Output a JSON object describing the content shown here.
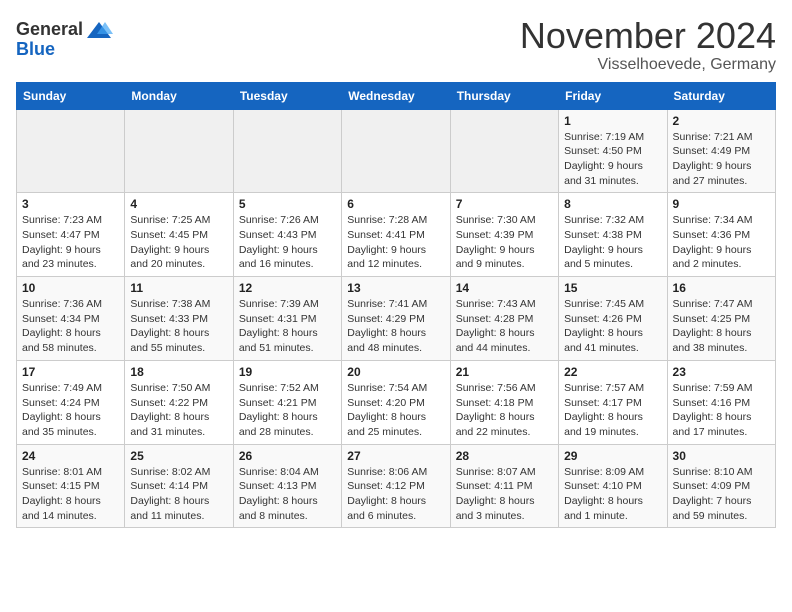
{
  "header": {
    "logo_general": "General",
    "logo_blue": "Blue",
    "month_title": "November 2024",
    "subtitle": "Visselhoevede, Germany"
  },
  "days_of_week": [
    "Sunday",
    "Monday",
    "Tuesday",
    "Wednesday",
    "Thursday",
    "Friday",
    "Saturday"
  ],
  "weeks": [
    [
      {
        "day": "",
        "detail": ""
      },
      {
        "day": "",
        "detail": ""
      },
      {
        "day": "",
        "detail": ""
      },
      {
        "day": "",
        "detail": ""
      },
      {
        "day": "",
        "detail": ""
      },
      {
        "day": "1",
        "detail": "Sunrise: 7:19 AM\nSunset: 4:50 PM\nDaylight: 9 hours and 31 minutes."
      },
      {
        "day": "2",
        "detail": "Sunrise: 7:21 AM\nSunset: 4:49 PM\nDaylight: 9 hours and 27 minutes."
      }
    ],
    [
      {
        "day": "3",
        "detail": "Sunrise: 7:23 AM\nSunset: 4:47 PM\nDaylight: 9 hours and 23 minutes."
      },
      {
        "day": "4",
        "detail": "Sunrise: 7:25 AM\nSunset: 4:45 PM\nDaylight: 9 hours and 20 minutes."
      },
      {
        "day": "5",
        "detail": "Sunrise: 7:26 AM\nSunset: 4:43 PM\nDaylight: 9 hours and 16 minutes."
      },
      {
        "day": "6",
        "detail": "Sunrise: 7:28 AM\nSunset: 4:41 PM\nDaylight: 9 hours and 12 minutes."
      },
      {
        "day": "7",
        "detail": "Sunrise: 7:30 AM\nSunset: 4:39 PM\nDaylight: 9 hours and 9 minutes."
      },
      {
        "day": "8",
        "detail": "Sunrise: 7:32 AM\nSunset: 4:38 PM\nDaylight: 9 hours and 5 minutes."
      },
      {
        "day": "9",
        "detail": "Sunrise: 7:34 AM\nSunset: 4:36 PM\nDaylight: 9 hours and 2 minutes."
      }
    ],
    [
      {
        "day": "10",
        "detail": "Sunrise: 7:36 AM\nSunset: 4:34 PM\nDaylight: 8 hours and 58 minutes."
      },
      {
        "day": "11",
        "detail": "Sunrise: 7:38 AM\nSunset: 4:33 PM\nDaylight: 8 hours and 55 minutes."
      },
      {
        "day": "12",
        "detail": "Sunrise: 7:39 AM\nSunset: 4:31 PM\nDaylight: 8 hours and 51 minutes."
      },
      {
        "day": "13",
        "detail": "Sunrise: 7:41 AM\nSunset: 4:29 PM\nDaylight: 8 hours and 48 minutes."
      },
      {
        "day": "14",
        "detail": "Sunrise: 7:43 AM\nSunset: 4:28 PM\nDaylight: 8 hours and 44 minutes."
      },
      {
        "day": "15",
        "detail": "Sunrise: 7:45 AM\nSunset: 4:26 PM\nDaylight: 8 hours and 41 minutes."
      },
      {
        "day": "16",
        "detail": "Sunrise: 7:47 AM\nSunset: 4:25 PM\nDaylight: 8 hours and 38 minutes."
      }
    ],
    [
      {
        "day": "17",
        "detail": "Sunrise: 7:49 AM\nSunset: 4:24 PM\nDaylight: 8 hours and 35 minutes."
      },
      {
        "day": "18",
        "detail": "Sunrise: 7:50 AM\nSunset: 4:22 PM\nDaylight: 8 hours and 31 minutes."
      },
      {
        "day": "19",
        "detail": "Sunrise: 7:52 AM\nSunset: 4:21 PM\nDaylight: 8 hours and 28 minutes."
      },
      {
        "day": "20",
        "detail": "Sunrise: 7:54 AM\nSunset: 4:20 PM\nDaylight: 8 hours and 25 minutes."
      },
      {
        "day": "21",
        "detail": "Sunrise: 7:56 AM\nSunset: 4:18 PM\nDaylight: 8 hours and 22 minutes."
      },
      {
        "day": "22",
        "detail": "Sunrise: 7:57 AM\nSunset: 4:17 PM\nDaylight: 8 hours and 19 minutes."
      },
      {
        "day": "23",
        "detail": "Sunrise: 7:59 AM\nSunset: 4:16 PM\nDaylight: 8 hours and 17 minutes."
      }
    ],
    [
      {
        "day": "24",
        "detail": "Sunrise: 8:01 AM\nSunset: 4:15 PM\nDaylight: 8 hours and 14 minutes."
      },
      {
        "day": "25",
        "detail": "Sunrise: 8:02 AM\nSunset: 4:14 PM\nDaylight: 8 hours and 11 minutes."
      },
      {
        "day": "26",
        "detail": "Sunrise: 8:04 AM\nSunset: 4:13 PM\nDaylight: 8 hours and 8 minutes."
      },
      {
        "day": "27",
        "detail": "Sunrise: 8:06 AM\nSunset: 4:12 PM\nDaylight: 8 hours and 6 minutes."
      },
      {
        "day": "28",
        "detail": "Sunrise: 8:07 AM\nSunset: 4:11 PM\nDaylight: 8 hours and 3 minutes."
      },
      {
        "day": "29",
        "detail": "Sunrise: 8:09 AM\nSunset: 4:10 PM\nDaylight: 8 hours and 1 minute."
      },
      {
        "day": "30",
        "detail": "Sunrise: 8:10 AM\nSunset: 4:09 PM\nDaylight: 7 hours and 59 minutes."
      }
    ]
  ]
}
